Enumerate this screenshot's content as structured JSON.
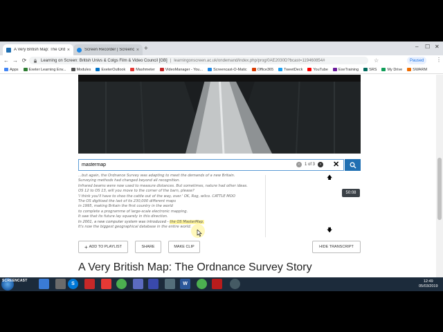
{
  "browser": {
    "tabs": [
      {
        "title": "A Very British Map: The Ordnance Survey Story",
        "active": true
      },
      {
        "title": "Screen Recorder | Screencast-O-Matic",
        "active": false
      }
    ],
    "nav": {
      "back": "←",
      "forward": "→",
      "reload": "⟳",
      "home": "⌂"
    },
    "address": {
      "host": "Learning on Screen: British Univs & Colgs Film & Video Council [GB]",
      "separator": "|",
      "url": "learningonscreen.ac.uk/ondemand/index.php/prog/0AE2030D?bcast=119460854#"
    },
    "profile_status": "Paused",
    "bookmarks": [
      {
        "label": "Apps",
        "color": "#4285f4"
      },
      {
        "label": "Exeter Learning Env...",
        "color": "#2e7d32"
      },
      {
        "label": "Modules",
        "color": "#555555"
      },
      {
        "label": "ExeterOutlook",
        "color": "#0072c6"
      },
      {
        "label": "Mashmeter",
        "color": "#e53935"
      },
      {
        "label": "VideoManager - You...",
        "color": "#c62828"
      },
      {
        "label": "Screencast-O-Matic",
        "color": "#1e88e5"
      },
      {
        "label": "Office365",
        "color": "#d83b01"
      },
      {
        "label": "TweetDeck",
        "color": "#1da1f2"
      },
      {
        "label": "YouTube",
        "color": "#ff0000"
      },
      {
        "label": "ExeTraining",
        "color": "#6a1b9a"
      },
      {
        "label": "SRS",
        "color": "#00695c"
      },
      {
        "label": "My Drive",
        "color": "#0f9d58"
      },
      {
        "label": "SWARM",
        "color": "#ef6c00"
      }
    ]
  },
  "player": {
    "search": {
      "value": "mastermap",
      "counter": "1 of 3",
      "clear": "✕"
    },
    "transcript_lines": [
      {
        "text": "...but again, the Ordnance Survey was adapting to meet the demands of a new Britain."
      },
      {
        "text": "Surveying methods had changed beyond all recognition."
      },
      {
        "text": "Infrared beams were now used to measure distances. But sometimes, nature had other ideas."
      },
      {
        "text": "OS 12 to OS 13, will you move to the corner of the barn, please?"
      },
      {
        "text": "'I think you'll have to shoo the cattle out of the way, over.' OK, Rog, wilco. CATTLE MOO"
      },
      {
        "text": "The OS digitised the last of its 230,000 different maps"
      },
      {
        "text": "in 1995, making Britain the first country in the world"
      },
      {
        "text": "to complete a programme of large-scale electronic mapping."
      },
      {
        "text": "It saw that its future lay squarely in this direction."
      },
      {
        "text": "In 2001, a new computer system was introduced - ",
        "highlight": "the OS MasterMap."
      },
      {
        "text": "It's now the biggest geographical database in the entire world."
      }
    ],
    "timestamp": "50:08",
    "buttons": {
      "add": "ADD TO PLAYLIST",
      "share": "SHARE",
      "clip": "MAKE CLIP",
      "hide": "HIDE TRANSCRIPT"
    }
  },
  "page_title": "A Very British Map: The Ordnance Survey Story",
  "taskbar": {
    "recorder_label": "SCREENCAST",
    "apps": [
      "S",
      "W"
    ],
    "clock_time": "12:49",
    "clock_date": "05/03/2019"
  },
  "colors": {
    "accent": "#1f6fb2",
    "highlight": "#fff59d"
  }
}
